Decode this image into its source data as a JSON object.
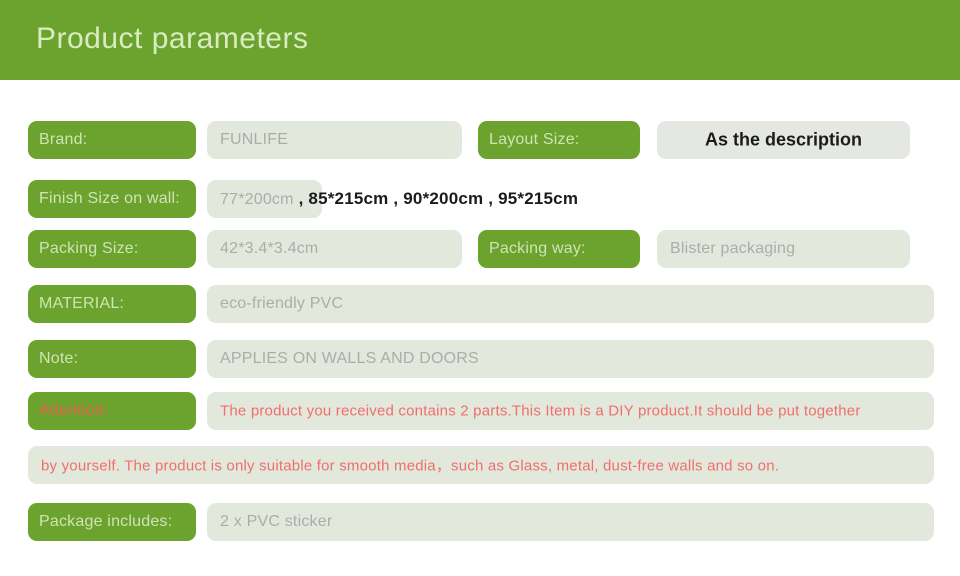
{
  "header": {
    "title": "Product parameters",
    "background_color": "#6ba32e",
    "text_color": "#d9ecc0"
  },
  "colors": {
    "green_pill": "#6ba32e",
    "pill_text": "#cfe4b4",
    "value_box": "#e3e8dd",
    "value_text": "#a9aeab",
    "emphasis_text": "#1b1b1b",
    "attention_red": "#ef6f6a",
    "attention_label_red": "#e8614c"
  },
  "rows": {
    "brand": {
      "label": "Brand:",
      "value": "FUNLIFE"
    },
    "layout_size": {
      "label": "Layout Size:",
      "value": "As the description"
    },
    "finish_size": {
      "label": "Finish Size on wall:",
      "value_first": "77*200cm",
      "value_rest": " ,  85*215cm ,  90*200cm ,  95*215cm",
      "value_full": "77*200cm , 85*215cm , 90*200cm , 95*215cm"
    },
    "packing_size": {
      "label": "Packing Size:",
      "value": "42*3.4*3.4cm"
    },
    "packing_way": {
      "label": "Packing way:",
      "value": "Blister packaging"
    },
    "material": {
      "label": "MATERIAL:",
      "value": "eco-friendly PVC"
    },
    "note": {
      "label": "Note:",
      "value": "APPLIES ON WALLS AND DOORS"
    },
    "attention": {
      "label": "Attention:",
      "value_line1": "The product you received contains 2 parts.This Item is a DIY product.It should be put together",
      "value_line2": "by yourself. The product is only suitable for smooth media，such as Glass, metal, dust-free walls and so on."
    },
    "package_includes": {
      "label": "Package includes:",
      "value": "2 x PVC sticker"
    }
  }
}
